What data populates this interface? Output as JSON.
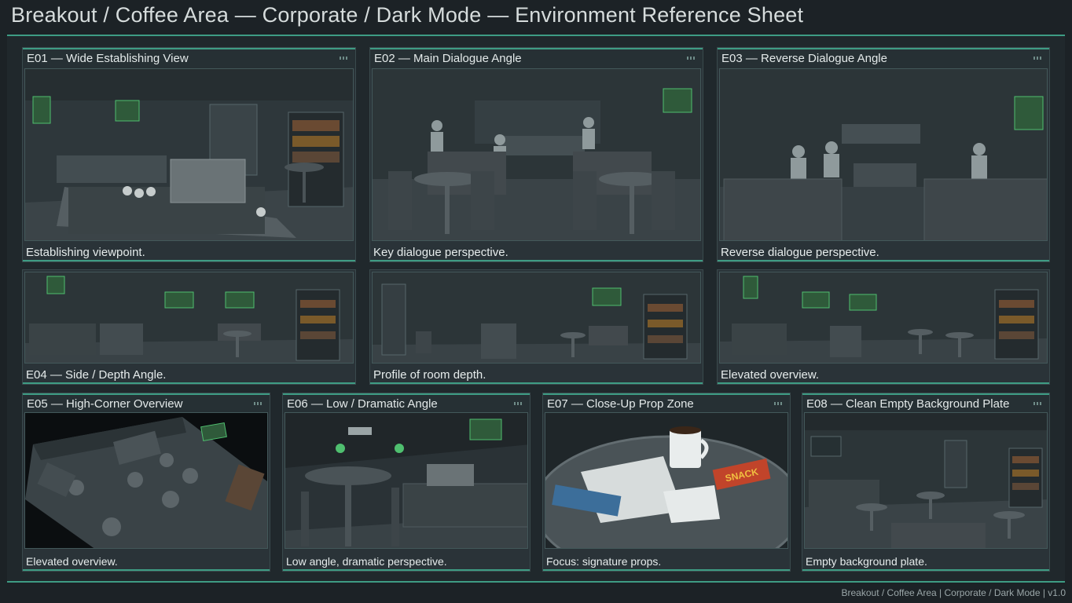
{
  "title": "Breakout / Coffee Area — Corporate / Dark Mode — Environment Reference Sheet",
  "footer": "Breakout / Coffee Area | Corporate / Dark Mode | v1.0",
  "panels": [
    {
      "label": "E01 — Wide Establishing View",
      "caption": "Establishing viewpoint."
    },
    {
      "label": "E02 — Main Dialogue Angle",
      "caption": "Key dialogue perspective."
    },
    {
      "label": "E03 — Reverse Dialogue Angle",
      "caption": "Reverse dialogue perspective."
    },
    {
      "label": "",
      "caption": "E04 — Side / Depth Angle."
    },
    {
      "label": "",
      "caption": "Profile of room depth."
    },
    {
      "label": "",
      "caption": "Elevated overview."
    },
    {
      "label": "E05 — High-Corner Overview",
      "caption": "Elevated overview."
    },
    {
      "label": "E06 — Low / Dramatic Angle",
      "caption": "Low angle, dramatic perspective."
    },
    {
      "label": "E07 — Close-Up Prop Zone",
      "caption": "Focus: signature props."
    },
    {
      "label": "E08 — Clean Empty Background Plate",
      "caption": "Empty background plate."
    }
  ],
  "props": {
    "snack_label": "SNACK"
  },
  "colors": {
    "accent": "#3e9c84",
    "screen": "#4fbf6f",
    "background": "#1c2226"
  }
}
